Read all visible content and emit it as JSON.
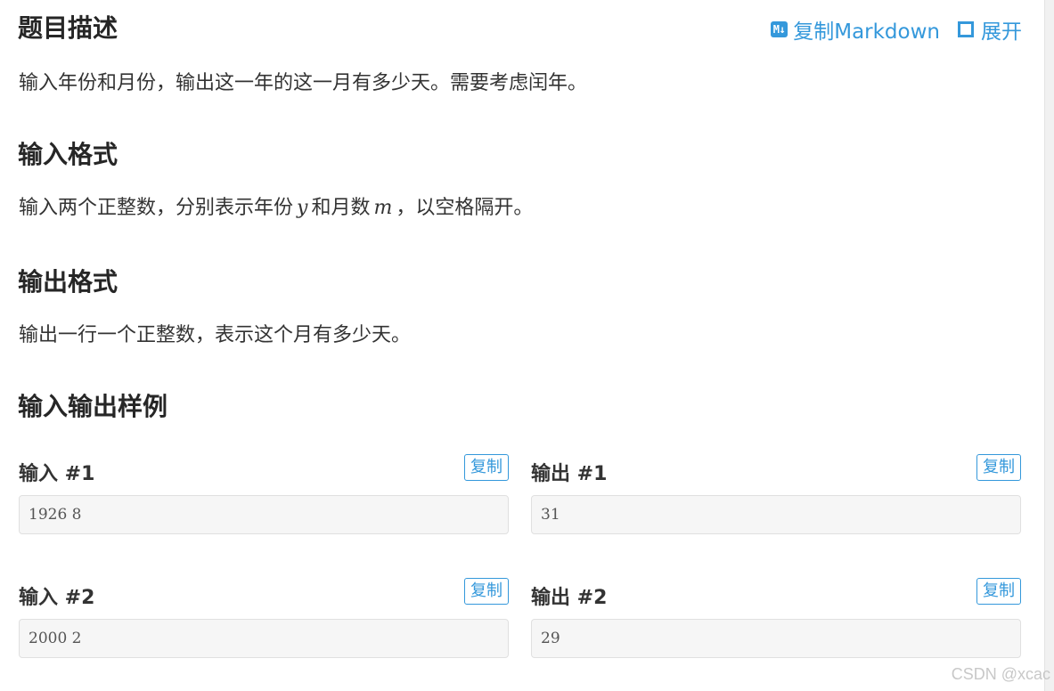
{
  "header": {
    "title": "题目描述",
    "copy_markdown_label": "复制Markdown",
    "md_icon_text": "M↓",
    "expand_label": "展开"
  },
  "description": {
    "text": "输入年份和月份，输出这一年的这一月有多少天。需要考虑闰年。"
  },
  "input_format": {
    "title": "输入格式",
    "text_before": "输入两个正整数，分别表示年份",
    "var_y": "y",
    "text_middle": "和月数",
    "var_m": "m",
    "text_after": "，以空格隔开。"
  },
  "output_format": {
    "title": "输出格式",
    "text": "输出一行一个正整数，表示这个月有多少天。"
  },
  "samples": {
    "title": "输入输出样例",
    "copy_label": "复制",
    "items": [
      {
        "input_title": "输入 #1",
        "input_value": "1926 8",
        "output_title": "输出 #1",
        "output_value": "31"
      },
      {
        "input_title": "输入 #2",
        "input_value": "2000 2",
        "output_title": "输出 #2",
        "output_value": "29"
      }
    ]
  },
  "watermark": "CSDN @xcac",
  "colors": {
    "accent": "#3498db",
    "heading": "#262626",
    "code_bg": "#f6f6f6"
  },
  "icons": [
    "markdown-icon",
    "fullscreen-icon"
  ]
}
